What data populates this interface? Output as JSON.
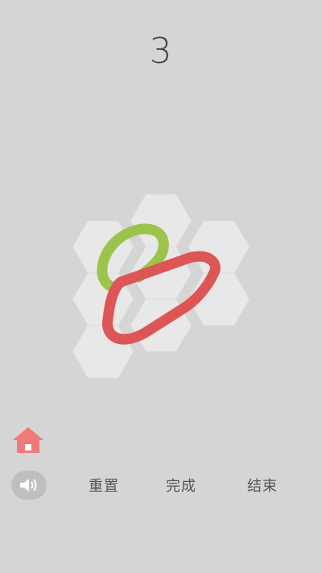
{
  "level": {
    "number": "3"
  },
  "board": {
    "tile_color": "#e8e8e8",
    "tile_border": "#d9d9d9",
    "tile_count": 9,
    "loops": [
      {
        "name": "green-loop",
        "color": "#9cc44c"
      },
      {
        "name": "red-loop",
        "color": "#dd5555"
      }
    ]
  },
  "controls": {
    "home_icon": "home-icon",
    "home_color": "#f07a7a",
    "sound_icon": "speaker-icon",
    "reset_label": "重置",
    "done_label": "完成",
    "end_label": "结束"
  }
}
